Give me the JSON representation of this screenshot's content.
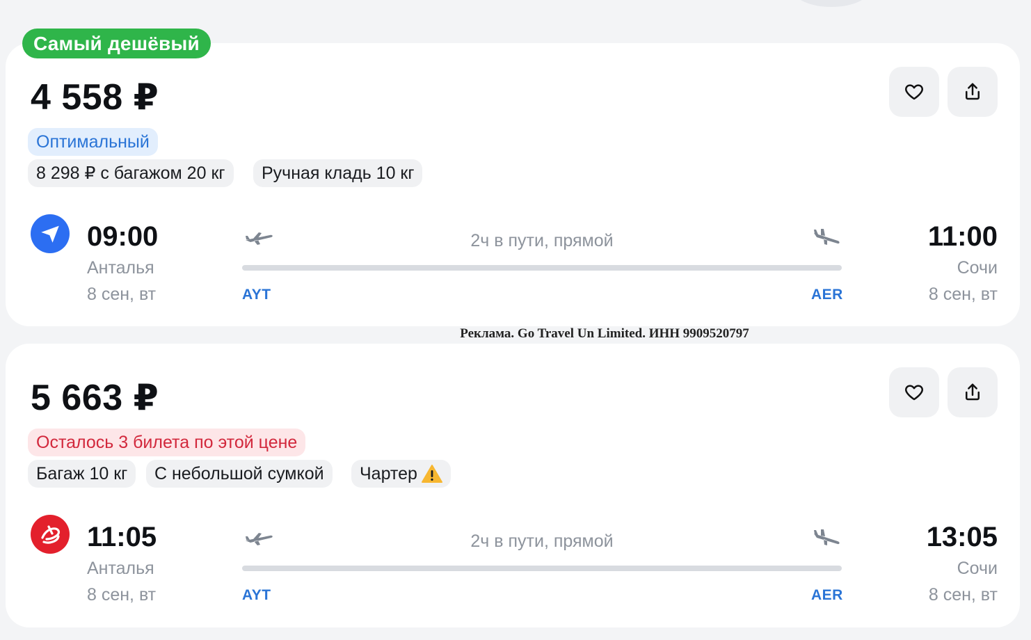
{
  "cards": [
    {
      "badge": "Самый дешёвый",
      "price": "4 558 ₽",
      "tag": "Оптимальный",
      "chips": [
        "8 298 ₽ с багажом 20 кг",
        "Ручная кладь 10 кг"
      ],
      "airline_logo": "blue-paper-plane-logo",
      "departure": {
        "time": "09:00",
        "city": "Анталья",
        "date": "8 сен, вт",
        "code": "AYT"
      },
      "arrival": {
        "time": "11:00",
        "city": "Сочи",
        "date": "8 сен, вт",
        "code": "AER"
      },
      "duration": "2ч в пути, прямой"
    },
    {
      "price": "5 663 ₽",
      "tag": "Осталось 3 билета по этой цене",
      "chips": [
        "Багаж 10 кг",
        "С небольшой сумкой",
        "Чартер"
      ],
      "charter_icon": "warning-icon",
      "airline_logo": "red-swirl-logo",
      "departure": {
        "time": "11:05",
        "city": "Анталья",
        "date": "8 сен, вт",
        "code": "AYT"
      },
      "arrival": {
        "time": "13:05",
        "city": "Сочи",
        "date": "8 сен, вт",
        "code": "AER"
      },
      "duration": "2ч в пути, прямой"
    }
  ],
  "ad_disclaimer": "Реклама. Go Travel Un Limited. ИНН 9909520797",
  "colors": {
    "badge_green": "#2fb54a",
    "tariff_blue": "#2a74d6",
    "warn_red": "#d2283c",
    "logo_blue": "#2c6ef2",
    "logo_red": "#e3202c"
  }
}
